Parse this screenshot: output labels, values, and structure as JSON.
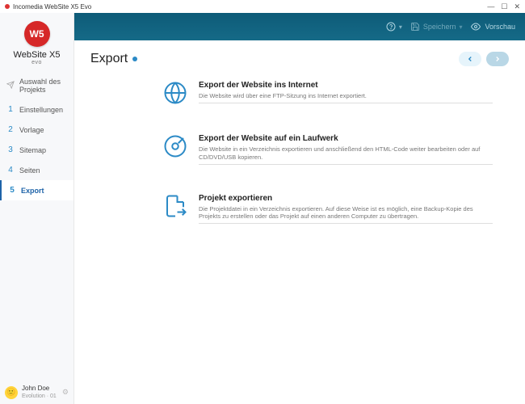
{
  "titlebar": {
    "appname": "Incomedia WebSite X5 Evo"
  },
  "brand": {
    "logo_text": "W5",
    "name": "WebSite X5",
    "sub": "evo"
  },
  "nav": {
    "intro_label": "Auswahl des Projekts",
    "items": [
      {
        "num": "1",
        "label": "Einstellungen"
      },
      {
        "num": "2",
        "label": "Vorlage"
      },
      {
        "num": "3",
        "label": "Sitemap"
      },
      {
        "num": "4",
        "label": "Seiten"
      },
      {
        "num": "5",
        "label": "Export"
      }
    ]
  },
  "user": {
    "name": "John Doe",
    "plan": "Evolution · 01"
  },
  "topbar": {
    "help": "?",
    "save": "Speichern",
    "preview": "Vorschau"
  },
  "header": {
    "title": "Export"
  },
  "options": [
    {
      "title": "Export der Website ins Internet",
      "desc": "Die Website wird über eine FTP-Sitzung ins Internet exportiert."
    },
    {
      "title": "Export der Website auf ein Laufwerk",
      "desc": "Die Website in ein Verzeichnis exportieren und anschließend den HTML-Code weiter bearbeiten oder auf CD/DVD/USB kopieren."
    },
    {
      "title": "Projekt exportieren",
      "desc": "Die Projektdatei in ein Verzeichnis exportieren. Auf diese Weise ist es möglich, eine Backup-Kopie des Projekts zu erstellen oder das Projekt auf einen anderen Computer zu übertragen."
    }
  ]
}
